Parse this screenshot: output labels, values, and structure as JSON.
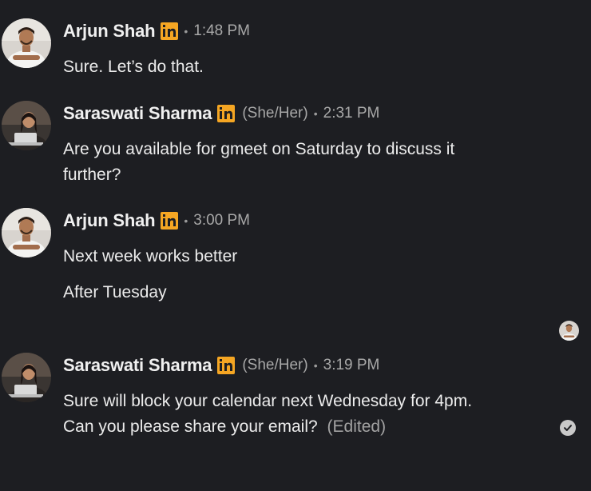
{
  "messages": [
    {
      "sender": "Arjun Shah",
      "pronouns": "",
      "time": "1:48 PM",
      "lines": [
        "Sure. Let’s do that."
      ]
    },
    {
      "sender": "Saraswati Sharma",
      "pronouns": "(She/Her)",
      "time": "2:31 PM",
      "lines": [
        "Are you available for gmeet on Saturday to discuss it further?"
      ]
    },
    {
      "sender": "Arjun Shah",
      "pronouns": "",
      "time": "3:00 PM",
      "lines": [
        "Next week works better",
        "After Tuesday"
      ]
    },
    {
      "sender": "Saraswati Sharma",
      "pronouns": "(She/Her)",
      "time": "3:19 PM",
      "lines": [
        "Sure will block your calendar next Wednesday for 4pm. Can you please share your email?"
      ],
      "edited_label": "(Edited)"
    }
  ],
  "separator": "•",
  "colors": {
    "background": "#1d1e22",
    "linkedin_badge": "#f5a623",
    "muted_text": "#a8a8a8"
  },
  "icons": {
    "premium_badge": "linkedin-premium-icon",
    "read_receipt": "read-receipt-avatar",
    "sent_status": "check-circle-icon"
  }
}
